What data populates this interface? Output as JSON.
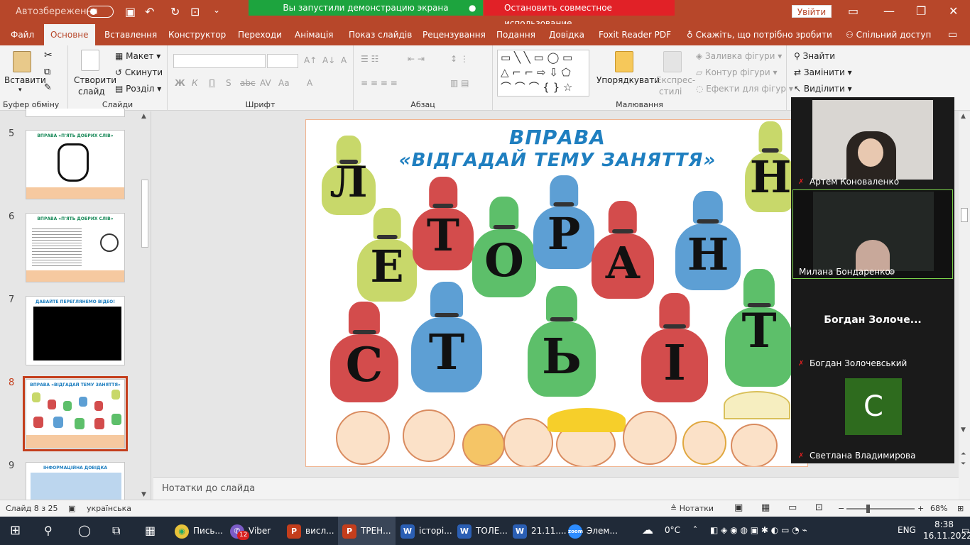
{
  "titlebar": {
    "autosave": "Автозбереження",
    "share_status": "Вы запустили демонстрацию экрана",
    "stop_share": "Остановить совместное использование",
    "login": "Увійти"
  },
  "tabs": [
    "Файл",
    "Основне",
    "Вставлення",
    "Конструктор",
    "Переходи",
    "Анімація",
    "Показ слайдів",
    "Рецензування",
    "Подання",
    "Довідка",
    "Foxit Reader PDF",
    "Скажіть, що потрібно зробити",
    "Спільний доступ"
  ],
  "ribbon": {
    "clipboard": {
      "paste": "Вставити",
      "label": "Буфер обміну"
    },
    "slides": {
      "new_slide_1": "Створити",
      "new_slide_2": "слайд",
      "layout": "Макет",
      "reset": "Скинути",
      "section": "Розділ",
      "label": "Слайди"
    },
    "font": {
      "label": "Шрифт",
      "bold": "Ж",
      "italic": "К",
      "underline": "П",
      "strike": "S",
      "abc": "abc",
      "spacing": "AV",
      "case": "Aa"
    },
    "paragraph": {
      "label": "Абзац"
    },
    "drawing": {
      "arrange": "Упорядкувати",
      "quick_styles_1": "Експрес-",
      "quick_styles_2": "стилі",
      "fill": "Заливка фігури",
      "outline": "Контур фігури",
      "effects": "Ефекти для фігур",
      "label": "Малювання"
    },
    "editing": {
      "find": "Знайти",
      "replace": "Замінити",
      "select": "Виділити"
    }
  },
  "thumbnails": [
    {
      "num": "5",
      "title": "ВПРАВА «П'ЯТЬ ДОБРИХ СЛІВ»"
    },
    {
      "num": "6",
      "title": "ВПРАВА «П'ЯТЬ ДОБРИХ СЛІВ»"
    },
    {
      "num": "7",
      "title": "ДАВАЙТЕ ПЕРЕГЛЯНЕМО ВІДЕО!"
    },
    {
      "num": "8",
      "title": "ВПРАВА «ВІДГАДАЙ ТЕМУ ЗАНЯТТЯ»"
    },
    {
      "num": "9",
      "title": "ІНФОРМАЦІЙНА ДОВІДКА"
    }
  ],
  "slide": {
    "title_line1": "ВПРАВА",
    "title_line2": "«ВІДГАДАЙ ТЕМУ ЗАНЯТТЯ»",
    "bags": [
      "Л",
      "Н",
      "Е",
      "Т",
      "О",
      "Р",
      "А",
      "Н",
      "С",
      "Т",
      "Ь",
      "І",
      "Т"
    ]
  },
  "notes_placeholder": "Нотатки до слайда",
  "status": {
    "slide_count": "Слайд 8 з 25",
    "language": "українська",
    "notes": "Нотатки",
    "zoom": "68%"
  },
  "zoom": {
    "participants": [
      {
        "name": "Артем Коноваленко",
        "bigname": ""
      },
      {
        "name": "Милана Бондаренко",
        "bigname": ""
      },
      {
        "name": "Богдан Золочевський",
        "bigname": "Богдан  Золоче..."
      },
      {
        "name": "Светлана Владимирова",
        "bigname": "",
        "initial": "С"
      }
    ]
  },
  "taskbar": {
    "items": [
      "Пись...",
      "Viber",
      "висл...",
      "ТРЕН...",
      "історі...",
      "ТОЛЕ...",
      "21.11....",
      "Элем..."
    ],
    "viber_badge": "12",
    "weather": "0°C",
    "lang": "ENG",
    "time": "8:38",
    "date": "16.11.2022"
  },
  "colors": {
    "accent": "#b7472a",
    "zoom_bg": "#1a1a1a",
    "title_blue": "#1f7fc0"
  }
}
